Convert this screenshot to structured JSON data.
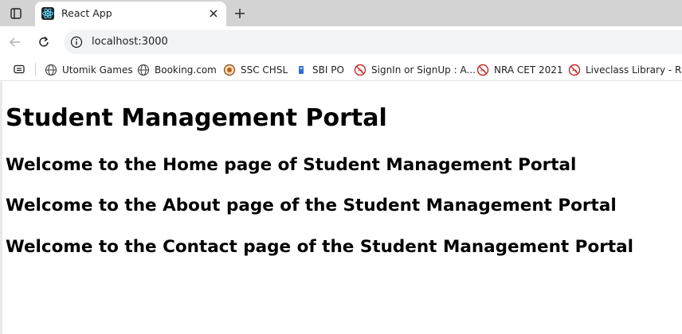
{
  "browser": {
    "tab": {
      "title": "React App",
      "favicon": "react-logo-icon"
    },
    "address_bar": {
      "url": "localhost:3000"
    },
    "bookmarks": [
      {
        "label": "Utomik Games",
        "icon": "globe-icon"
      },
      {
        "label": "Booking.com",
        "icon": "globe-icon"
      },
      {
        "label": "SSC CHSL",
        "icon": "emblem-icon"
      },
      {
        "label": "SBI PO",
        "icon": "bookmark-favicon-icon"
      },
      {
        "label": "SignIn or SignUp : A...",
        "icon": "blocked-icon"
      },
      {
        "label": "NRA CET 2021",
        "icon": "blocked-icon"
      },
      {
        "label": "Liveclass Library - R...",
        "icon": "blocked-icon"
      }
    ],
    "colors": {
      "tabstrip": "#d3d3d3",
      "omnibox": "#f1f3f4",
      "blocked_red": "#c62828"
    }
  },
  "page": {
    "title": "Student Management Portal",
    "sections": [
      "Welcome to the Home page of Student Management Portal",
      "Welcome to the About page of the Student Management Portal",
      "Welcome to the Contact page of the Student Management Portal"
    ]
  }
}
